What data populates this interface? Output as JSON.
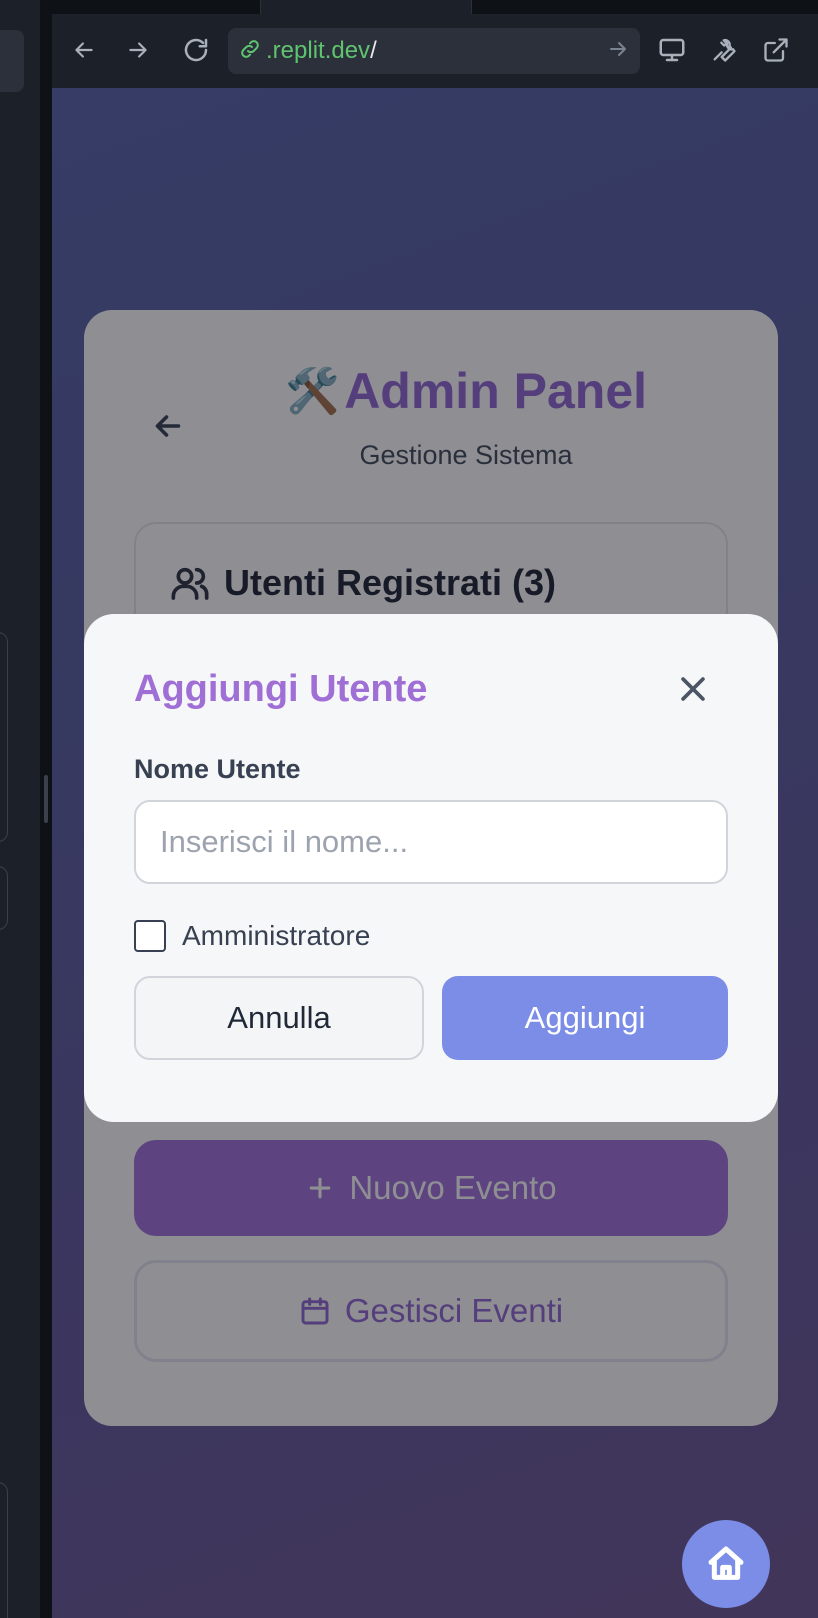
{
  "browser": {
    "url_domain": ".replit.dev",
    "url_path": "/"
  },
  "admin": {
    "title_icon": "🛠️",
    "title": "Admin Panel",
    "subtitle": "Gestione Sistema",
    "users_heading": "Utenti Registrati (3)",
    "new_event_label": "Nuovo Evento",
    "manage_events_label": "Gestisci Eventi"
  },
  "modal": {
    "title": "Aggiungi Utente",
    "field_label": "Nome Utente",
    "name_value": "",
    "name_placeholder": "Inserisci il nome...",
    "admin_checkbox_label": "Amministratore",
    "admin_checked": false,
    "cancel_label": "Annulla",
    "submit_label": "Aggiungi"
  },
  "colors": {
    "accent_purple": "#8c5fd0",
    "primary_blue": "#7b8de6",
    "url_green": "#5fc46f"
  },
  "icons": {
    "back": "arrow-left-icon",
    "users": "users-icon",
    "close": "close-icon",
    "plus": "plus-icon",
    "calendar": "calendar-icon",
    "home": "home-icon"
  }
}
